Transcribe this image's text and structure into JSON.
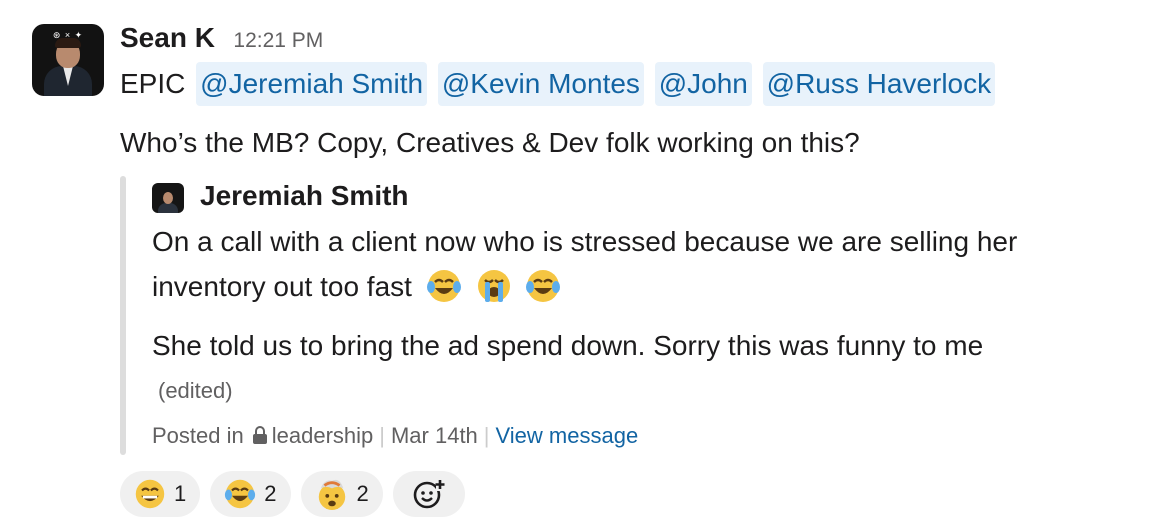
{
  "message": {
    "sender": "Sean K",
    "time": "12:21 PM",
    "prefix": "EPIC",
    "mentions": [
      "@Jeremiah Smith",
      "@Kevin Montes",
      "@John",
      "@Russ Haverlock"
    ],
    "body": "Who’s the MB? Copy, Creatives & Dev folk working on this?"
  },
  "quote": {
    "author": "Jeremiah Smith",
    "line1": "On a call with a client now who is stressed because we are selling her",
    "line2": "inventory out too fast",
    "line2_emojis": [
      "joy-emoji",
      "loudly-crying-emoji",
      "joy-emoji"
    ],
    "line3": "She told us to bring the ad spend down. Sorry this was funny to me",
    "edited": "(edited)",
    "posted_in": "Posted in",
    "channel": "leadership",
    "date": "Mar 14th",
    "view_link": "View message"
  },
  "reactions": [
    {
      "icon": "grinning-face-emoji",
      "count": "1"
    },
    {
      "icon": "joy-emoji",
      "count": "2"
    },
    {
      "icon": "exploding-head-emoji",
      "count": "2"
    },
    {
      "icon": "add-reaction-icon"
    }
  ]
}
